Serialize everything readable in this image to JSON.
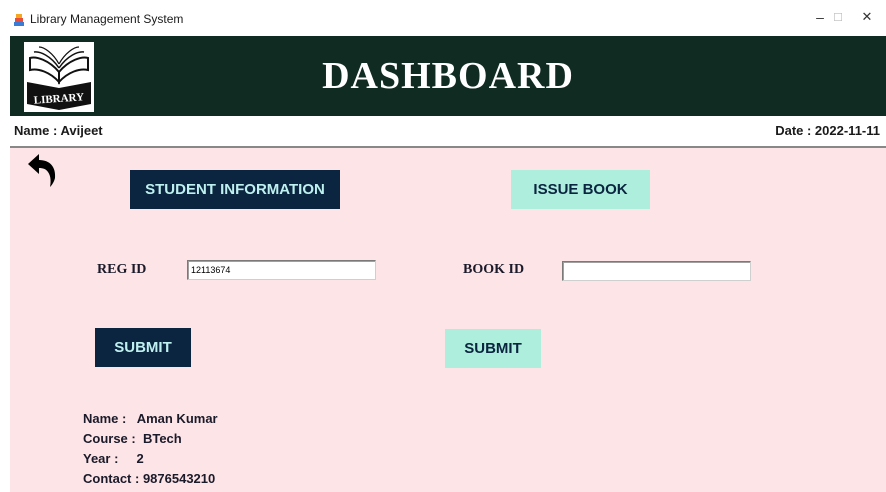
{
  "window": {
    "title": "Library Management System",
    "controls": {
      "minimize": "–",
      "maximize": "☐",
      "close": "✕"
    }
  },
  "header": {
    "logo_text": "LIBRARY",
    "title": "DASHBOARD"
  },
  "info": {
    "name_label": "Name : Avijeet",
    "date_label": "Date : 2022-11-11"
  },
  "actions": {
    "student_info_label": "STUDENT INFORMATION",
    "issue_book_label": "ISSUE BOOK"
  },
  "form": {
    "reg_id_label": "REG ID",
    "reg_id_value": "12113674",
    "book_id_label": "BOOK ID",
    "book_id_value": "",
    "submit_left_label": "SUBMIT",
    "submit_right_label": "SUBMIT"
  },
  "student": {
    "name": "Name :   Aman Kumar",
    "course": "Course :  BTech",
    "year": "Year :     2",
    "contact": "Contact : 9876543210"
  },
  "colors": {
    "header_bg": "#0f2b22",
    "main_bg": "#fde4e6",
    "dark_button": "#0b2540",
    "mint_button": "#aeeedd"
  },
  "icons": {
    "app": "book-stack-icon",
    "back": "back-arrow-icon",
    "logo": "library-book-logo"
  }
}
